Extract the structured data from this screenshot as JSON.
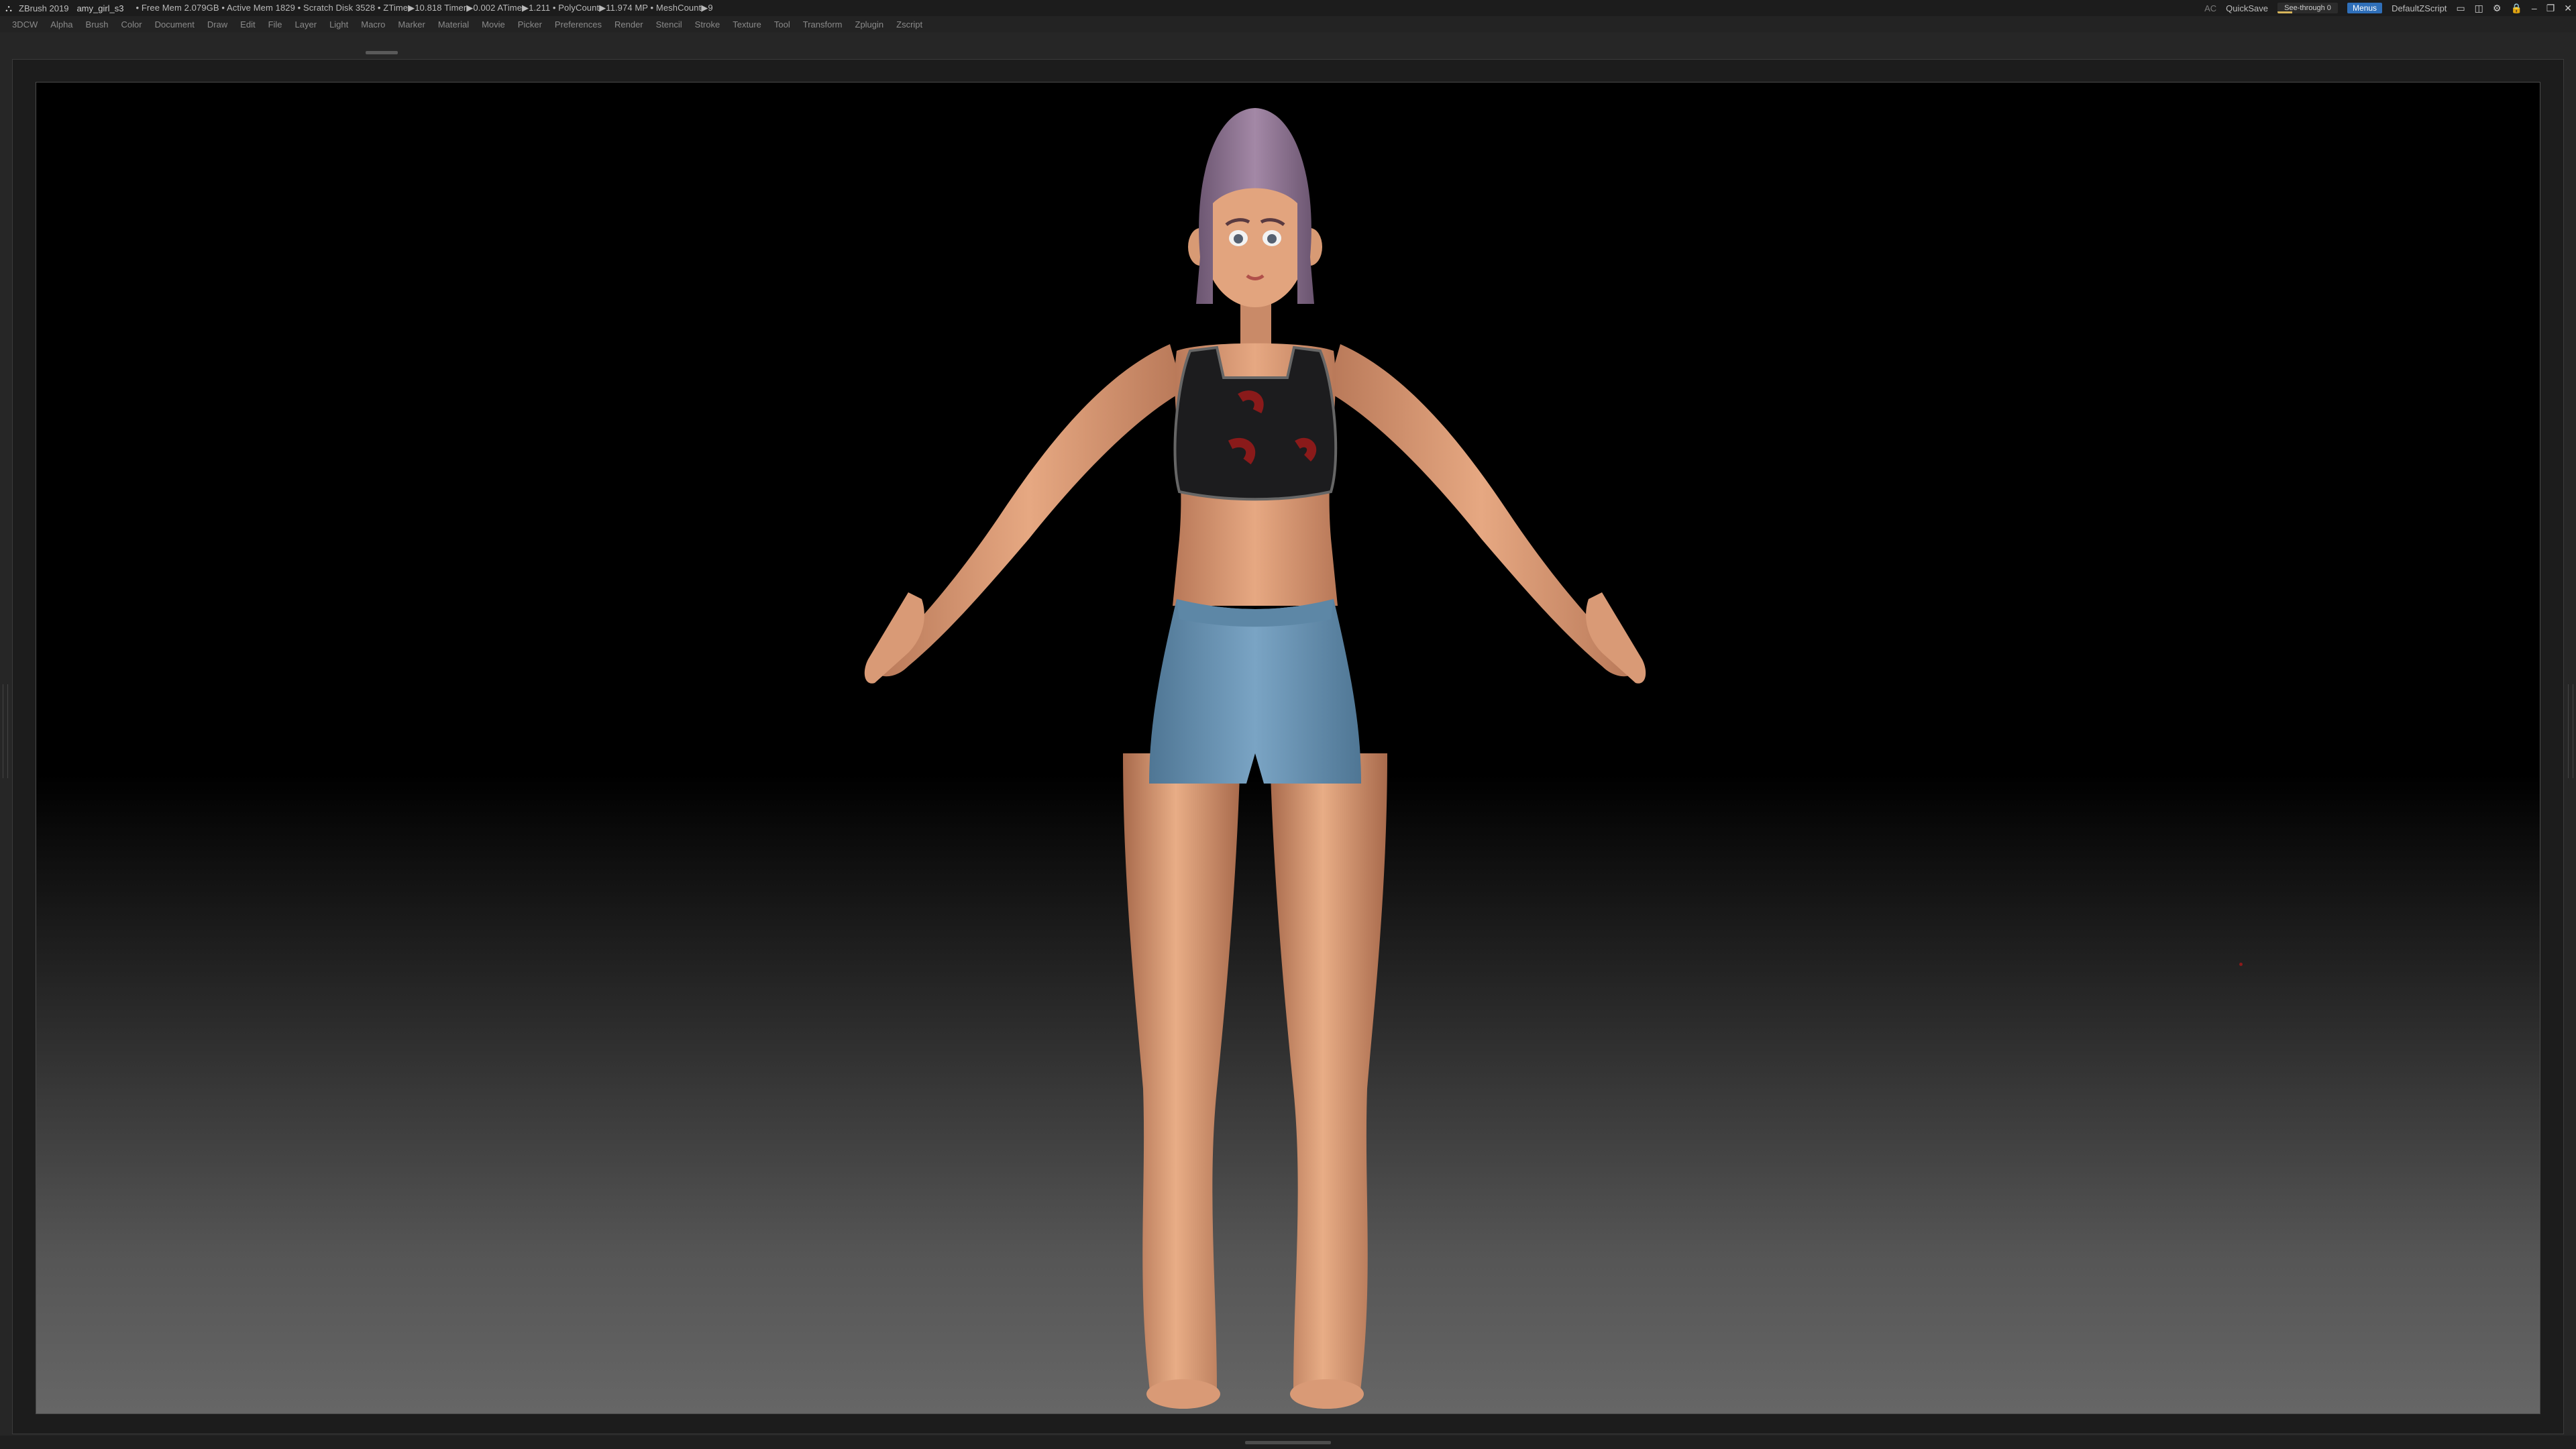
{
  "titlebar": {
    "app_name": "ZBrush 2019",
    "file_name": "amy_girl_s3",
    "stats": "• Free Mem 2.079GB • Active Mem 1829 • Scratch Disk 3528 • ZTime▶10.818 Timer▶0.002 ATime▶1.211 • PolyCount▶11.974 MP • MeshCount▶9",
    "ac_label": "AC",
    "quicksave_label": "QuickSave",
    "seethrough_label": "See-through 0",
    "seethrough_level": 0,
    "menus_label": "Menus",
    "script_label": "DefaultZScript"
  },
  "menubar": {
    "items": [
      "3DCW",
      "Alpha",
      "Brush",
      "Color",
      "Document",
      "Draw",
      "Edit",
      "File",
      "Layer",
      "Light",
      "Macro",
      "Marker",
      "Material",
      "Movie",
      "Picker",
      "Preferences",
      "Render",
      "Stencil",
      "Stroke",
      "Texture",
      "Tool",
      "Transform",
      "Zplugin",
      "Zscript"
    ]
  },
  "colors": {
    "menus_accent": "#2f6fb9",
    "seethrough_accent": "#d6b45a",
    "skin": "#e0a27c",
    "hair": "#8d6f8e",
    "top": "#1c1c1e",
    "shorts": "#6e98b8"
  },
  "icons": [
    "zbrush-logo-icon",
    "layout-icon",
    "minimize-icon",
    "maximize-icon",
    "close-icon"
  ]
}
